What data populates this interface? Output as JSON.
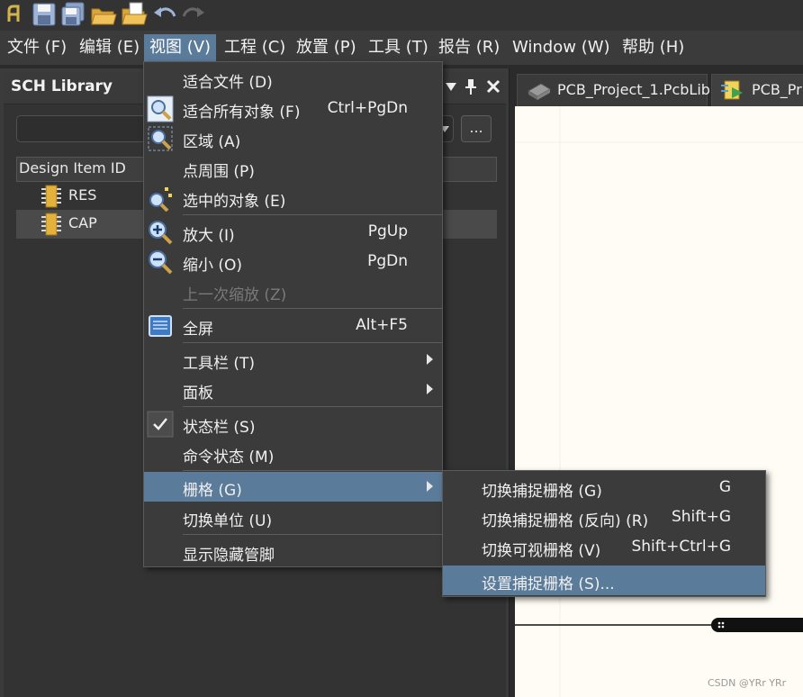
{
  "menubar": {
    "items": [
      "文件 (F)",
      "编辑 (E)",
      "视图 (V)",
      "工程 (C)",
      "放置 (P)",
      "工具 (T)",
      "报告 (R)",
      "Window (W)",
      "帮助 (H)"
    ]
  },
  "panel": {
    "title": "SCH Library",
    "browse_label": "...",
    "column_header": "Design Item ID",
    "components": [
      "RES",
      "CAP"
    ]
  },
  "tabs": [
    "PCB_Project_1.PcbLib",
    "PCB_Pr"
  ],
  "view_menu": {
    "items": [
      {
        "label": "适合文件 (D)",
        "shortcut": ""
      },
      {
        "label": "适合所有对象 (F)",
        "shortcut": "Ctrl+PgDn"
      },
      {
        "label": "区域 (A)",
        "shortcut": ""
      },
      {
        "label": "点周围 (P)",
        "shortcut": ""
      },
      {
        "label": "选中的对象 (E)",
        "shortcut": ""
      },
      {
        "label": "放大 (I)",
        "shortcut": "PgUp"
      },
      {
        "label": "缩小 (O)",
        "shortcut": "PgDn"
      },
      {
        "label": "上一次缩放 (Z)",
        "shortcut": ""
      },
      {
        "label": "全屏",
        "shortcut": "Alt+F5"
      },
      {
        "label": "工具栏 (T)",
        "shortcut": ""
      },
      {
        "label": "面板",
        "shortcut": ""
      },
      {
        "label": "状态栏 (S)",
        "shortcut": ""
      },
      {
        "label": "命令状态 (M)",
        "shortcut": ""
      },
      {
        "label": "栅格 (G)",
        "shortcut": ""
      },
      {
        "label": "切换单位 (U)",
        "shortcut": ""
      },
      {
        "label": "显示隐藏管脚",
        "shortcut": ""
      }
    ]
  },
  "grid_submenu": {
    "items": [
      {
        "label": "切换捕捉栅格 (G)",
        "shortcut": "G"
      },
      {
        "label": "切换捕捉栅格 (反向) (R)",
        "shortcut": "Shift+G"
      },
      {
        "label": "切换可视栅格 (V)",
        "shortcut": "Shift+Ctrl+G"
      },
      {
        "label": "设置捕捉栅格 (S)...",
        "shortcut": ""
      }
    ]
  },
  "watermark": "CSDN @YRr YRr",
  "colors": {
    "highlight": "#5b7b9a",
    "menu_bg": "#3b3b3b",
    "canvas_bg": "#fffcf5"
  }
}
